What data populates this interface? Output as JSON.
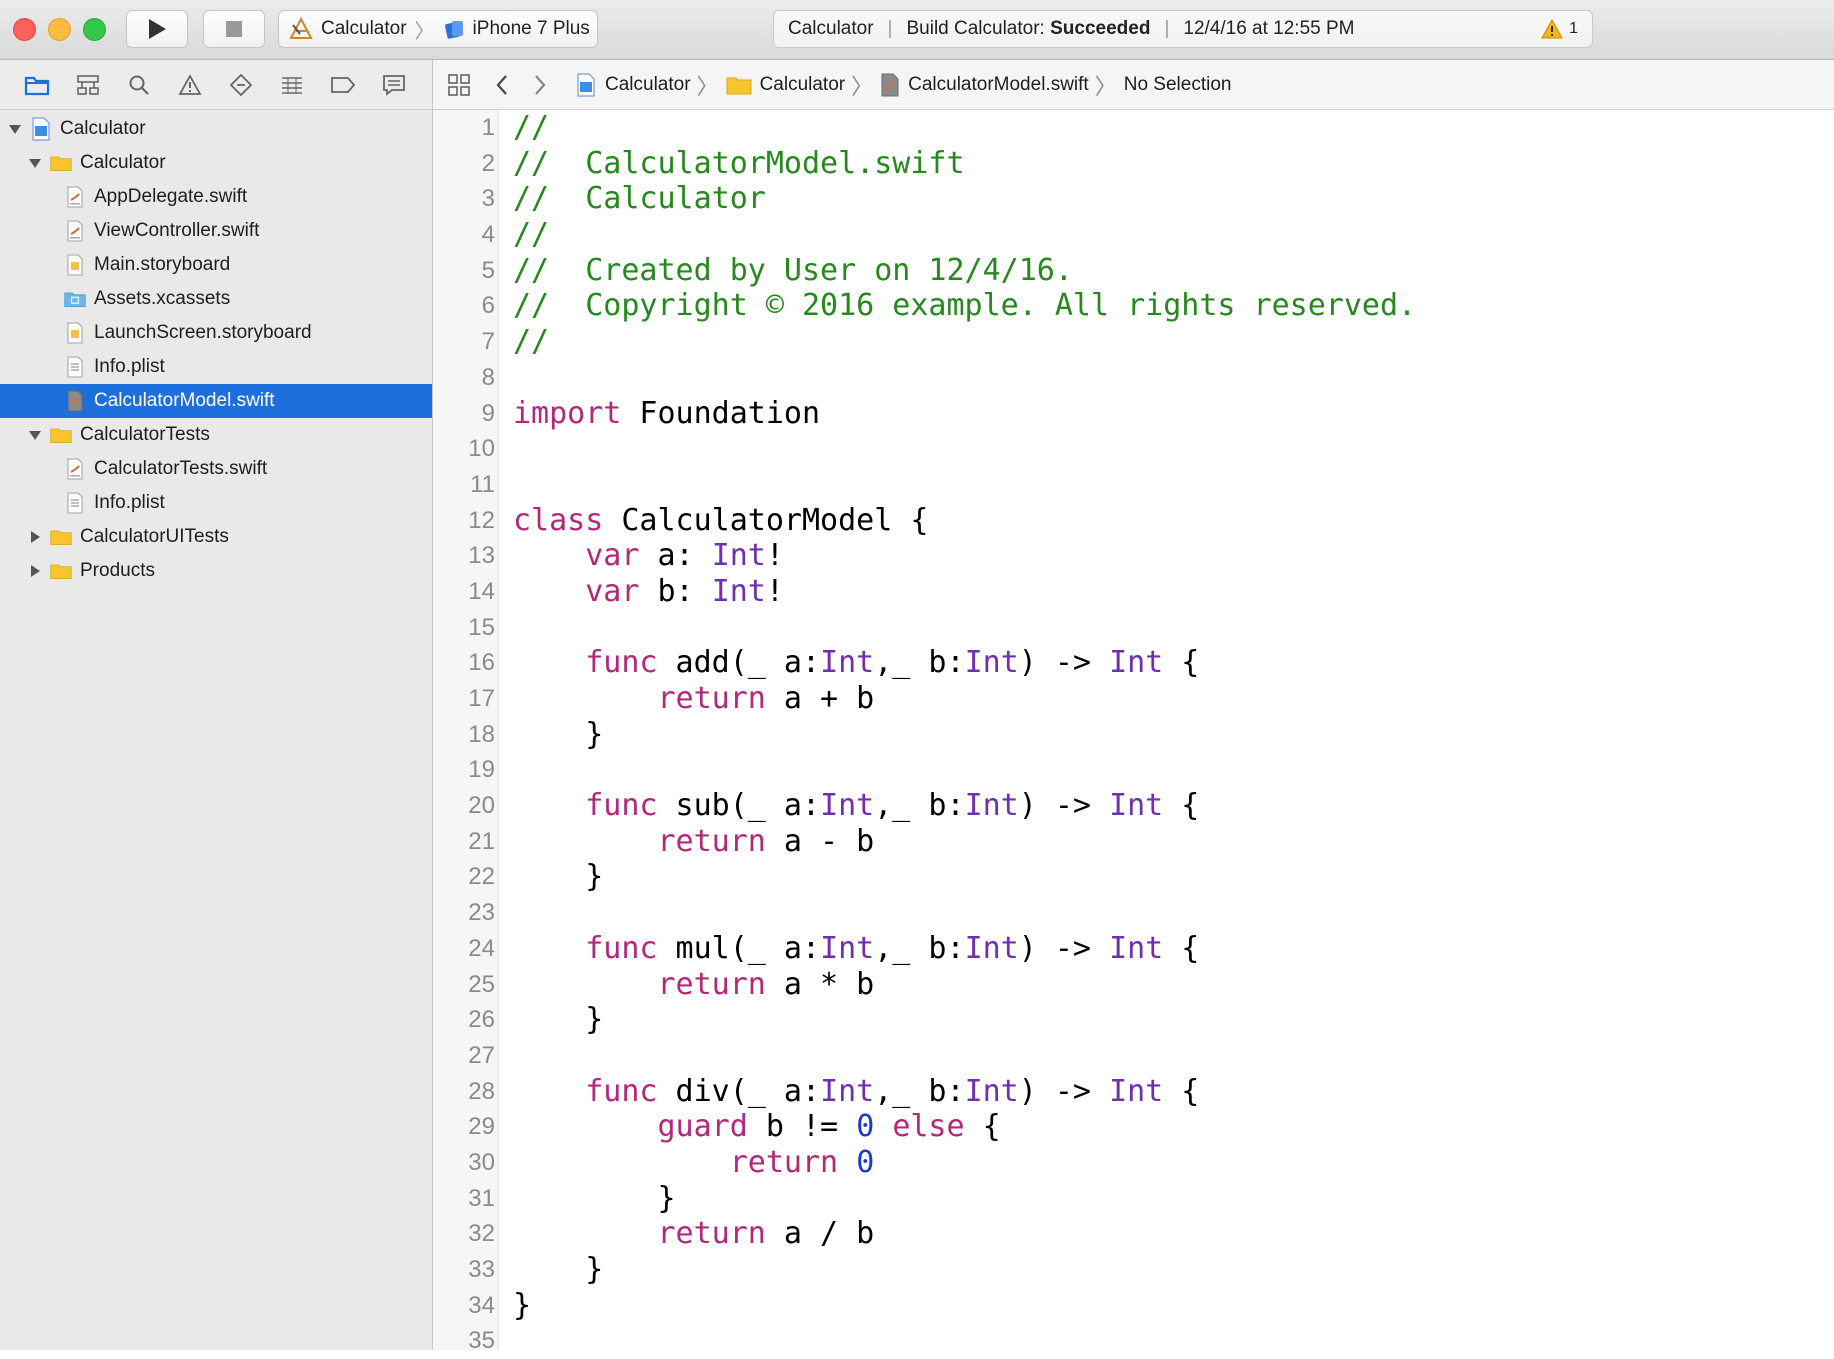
{
  "toolbar": {
    "scheme": "Calculator",
    "device": "iPhone 7 Plus",
    "activity": {
      "project": "Calculator",
      "status_prefix": "Build Calculator:",
      "status_result": "Succeeded",
      "timestamp": "12/4/16 at 12:55 PM",
      "warning_count": "1"
    }
  },
  "navigator": {
    "tabs": [
      "folder-icon",
      "hierarchy-icon",
      "search-icon",
      "warning-icon",
      "test-diamond-icon",
      "debug-list-icon",
      "breakpoint-icon",
      "report-icon"
    ],
    "tree": [
      {
        "label": "Calculator",
        "level": 0,
        "disclosure": "open",
        "icon": "project-icon"
      },
      {
        "label": "Calculator",
        "level": 1,
        "disclosure": "open",
        "icon": "folder-icon"
      },
      {
        "label": "AppDelegate.swift",
        "level": 2,
        "icon": "swift-file-icon"
      },
      {
        "label": "ViewController.swift",
        "level": 2,
        "icon": "swift-file-icon"
      },
      {
        "label": "Main.storyboard",
        "level": 2,
        "icon": "storyboard-icon"
      },
      {
        "label": "Assets.xcassets",
        "level": 2,
        "icon": "assets-folder-icon"
      },
      {
        "label": "LaunchScreen.storyboard",
        "level": 2,
        "icon": "storyboard-icon"
      },
      {
        "label": "Info.plist",
        "level": 2,
        "icon": "plist-icon"
      },
      {
        "label": "CalculatorModel.swift",
        "level": 2,
        "icon": "swift-file-icon",
        "selected": true
      },
      {
        "label": "CalculatorTests",
        "level": 1,
        "disclosure": "open",
        "icon": "folder-icon"
      },
      {
        "label": "CalculatorTests.swift",
        "level": 2,
        "icon": "swift-file-icon"
      },
      {
        "label": "Info.plist",
        "level": 2,
        "icon": "plist-icon"
      },
      {
        "label": "CalculatorUITests",
        "level": 1,
        "disclosure": "closed",
        "icon": "folder-icon"
      },
      {
        "label": "Products",
        "level": 1,
        "disclosure": "closed",
        "icon": "folder-icon"
      }
    ]
  },
  "jumpbar": {
    "crumbs": [
      "Calculator",
      "Calculator",
      "CalculatorModel.swift",
      "No Selection"
    ]
  },
  "editor": {
    "lines": [
      [
        [
          "c",
          "//"
        ]
      ],
      [
        [
          "c",
          "//  CalculatorModel.swift"
        ]
      ],
      [
        [
          "c",
          "//  Calculator"
        ]
      ],
      [
        [
          "c",
          "//"
        ]
      ],
      [
        [
          "c",
          "//  Created by User on 12/4/16."
        ]
      ],
      [
        [
          "c",
          "//  Copyright © 2016 example. All rights reserved."
        ]
      ],
      [
        [
          "c",
          "//"
        ]
      ],
      [],
      [
        [
          "k",
          "import"
        ],
        [
          "p",
          " Foundation"
        ]
      ],
      [],
      [],
      [
        [
          "k",
          "class"
        ],
        [
          "p",
          " CalculatorModel {"
        ]
      ],
      [
        [
          "p",
          "    "
        ],
        [
          "k",
          "var"
        ],
        [
          "p",
          " a: "
        ],
        [
          "t",
          "Int"
        ],
        [
          "p",
          "!"
        ]
      ],
      [
        [
          "p",
          "    "
        ],
        [
          "k",
          "var"
        ],
        [
          "p",
          " b: "
        ],
        [
          "t",
          "Int"
        ],
        [
          "p",
          "!"
        ]
      ],
      [],
      [
        [
          "p",
          "    "
        ],
        [
          "k",
          "func"
        ],
        [
          "p",
          " add(_ a:"
        ],
        [
          "t",
          "Int"
        ],
        [
          "p",
          ",_ b:"
        ],
        [
          "t",
          "Int"
        ],
        [
          "p",
          ") -> "
        ],
        [
          "t",
          "Int"
        ],
        [
          "p",
          " {"
        ]
      ],
      [
        [
          "p",
          "        "
        ],
        [
          "k",
          "return"
        ],
        [
          "p",
          " a + b"
        ]
      ],
      [
        [
          "p",
          "    }"
        ]
      ],
      [],
      [
        [
          "p",
          "    "
        ],
        [
          "k",
          "func"
        ],
        [
          "p",
          " sub(_ a:"
        ],
        [
          "t",
          "Int"
        ],
        [
          "p",
          ",_ b:"
        ],
        [
          "t",
          "Int"
        ],
        [
          "p",
          ") -> "
        ],
        [
          "t",
          "Int"
        ],
        [
          "p",
          " {"
        ]
      ],
      [
        [
          "p",
          "        "
        ],
        [
          "k",
          "return"
        ],
        [
          "p",
          " a - b"
        ]
      ],
      [
        [
          "p",
          "    }"
        ]
      ],
      [],
      [
        [
          "p",
          "    "
        ],
        [
          "k",
          "func"
        ],
        [
          "p",
          " mul(_ a:"
        ],
        [
          "t",
          "Int"
        ],
        [
          "p",
          ",_ b:"
        ],
        [
          "t",
          "Int"
        ],
        [
          "p",
          ") -> "
        ],
        [
          "t",
          "Int"
        ],
        [
          "p",
          " {"
        ]
      ],
      [
        [
          "p",
          "        "
        ],
        [
          "k",
          "return"
        ],
        [
          "p",
          " a * b"
        ]
      ],
      [
        [
          "p",
          "    }"
        ]
      ],
      [],
      [
        [
          "p",
          "    "
        ],
        [
          "k",
          "func"
        ],
        [
          "p",
          " div(_ a:"
        ],
        [
          "t",
          "Int"
        ],
        [
          "p",
          ",_ b:"
        ],
        [
          "t",
          "Int"
        ],
        [
          "p",
          ") -> "
        ],
        [
          "t",
          "Int"
        ],
        [
          "p",
          " {"
        ]
      ],
      [
        [
          "p",
          "        "
        ],
        [
          "k",
          "guard"
        ],
        [
          "p",
          " b != "
        ],
        [
          "n",
          "0"
        ],
        [
          "p",
          " "
        ],
        [
          "k",
          "else"
        ],
        [
          "p",
          " {"
        ]
      ],
      [
        [
          "p",
          "            "
        ],
        [
          "k",
          "return"
        ],
        [
          "p",
          " "
        ],
        [
          "n",
          "0"
        ]
      ],
      [
        [
          "p",
          "        }"
        ]
      ],
      [
        [
          "p",
          "        "
        ],
        [
          "k",
          "return"
        ],
        [
          "p",
          " a / b"
        ]
      ],
      [
        [
          "p",
          "    }"
        ]
      ],
      [
        [
          "p",
          "}"
        ]
      ],
      []
    ]
  }
}
